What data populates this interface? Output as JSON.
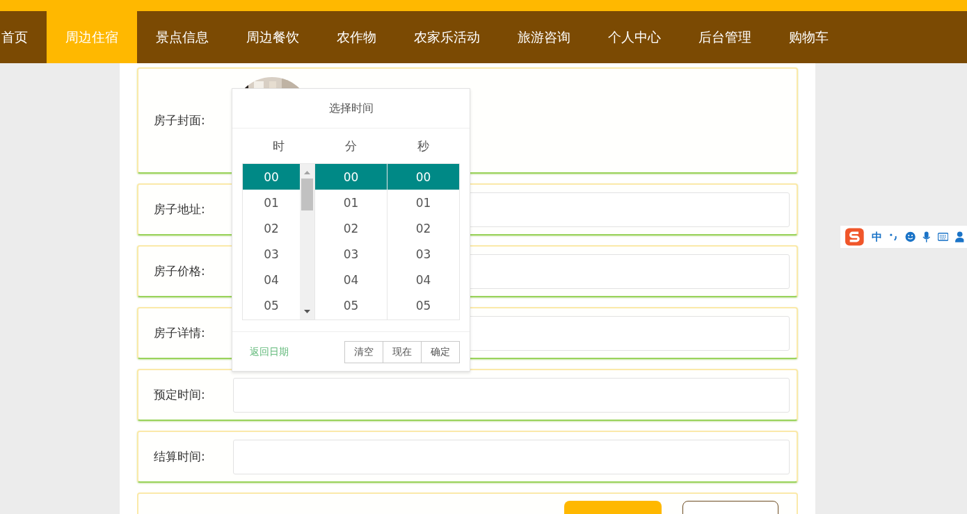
{
  "nav": {
    "items": [
      {
        "label": "首页",
        "selected": false
      },
      {
        "label": "周边住宿",
        "selected": true
      },
      {
        "label": "景点信息",
        "selected": false
      },
      {
        "label": "周边餐饮",
        "selected": false
      },
      {
        "label": "农作物",
        "selected": false
      },
      {
        "label": "农家乐活动",
        "selected": false
      },
      {
        "label": "旅游咨询",
        "selected": false
      },
      {
        "label": "个人中心",
        "selected": false
      },
      {
        "label": "后台管理",
        "selected": false
      },
      {
        "label": "购物车",
        "selected": false
      }
    ]
  },
  "form": {
    "rows": [
      {
        "label": "房子封面:"
      },
      {
        "kind": "input",
        "label": "房子地址:"
      },
      {
        "kind": "input",
        "label": "房子价格:"
      },
      {
        "kind": "input",
        "label": "房子详情:"
      },
      {
        "kind": "input",
        "label": "预定时间:"
      },
      {
        "kind": "input",
        "label": "结算时间:"
      }
    ],
    "buttons": [
      {
        "kind": "primary"
      },
      {
        "kind": "outline"
      }
    ]
  },
  "time_picker": {
    "title": "选择时间",
    "columns": [
      {
        "header": "时",
        "has_scrollbar": true,
        "options": [
          {
            "label": "00",
            "selected": true
          },
          {
            "label": "01",
            "selected": false
          },
          {
            "label": "02",
            "selected": false
          },
          {
            "label": "03",
            "selected": false
          },
          {
            "label": "04",
            "selected": false
          },
          {
            "label": "05",
            "selected": false
          }
        ]
      },
      {
        "header": "分",
        "has_scrollbar": false,
        "options": [
          {
            "label": "00",
            "selected": true
          },
          {
            "label": "01",
            "selected": false
          },
          {
            "label": "02",
            "selected": false
          },
          {
            "label": "03",
            "selected": false
          },
          {
            "label": "04",
            "selected": false
          },
          {
            "label": "05",
            "selected": false
          }
        ]
      },
      {
        "header": "秒",
        "has_scrollbar": false,
        "options": [
          {
            "label": "00",
            "selected": true
          },
          {
            "label": "01",
            "selected": false
          },
          {
            "label": "02",
            "selected": false
          },
          {
            "label": "03",
            "selected": false
          },
          {
            "label": "04",
            "selected": false
          },
          {
            "label": "05",
            "selected": false
          }
        ]
      }
    ],
    "back_link": "返回日期",
    "buttons": [
      "清空",
      "现在",
      "确定"
    ]
  },
  "ime_bar": {
    "mode": "中"
  }
}
